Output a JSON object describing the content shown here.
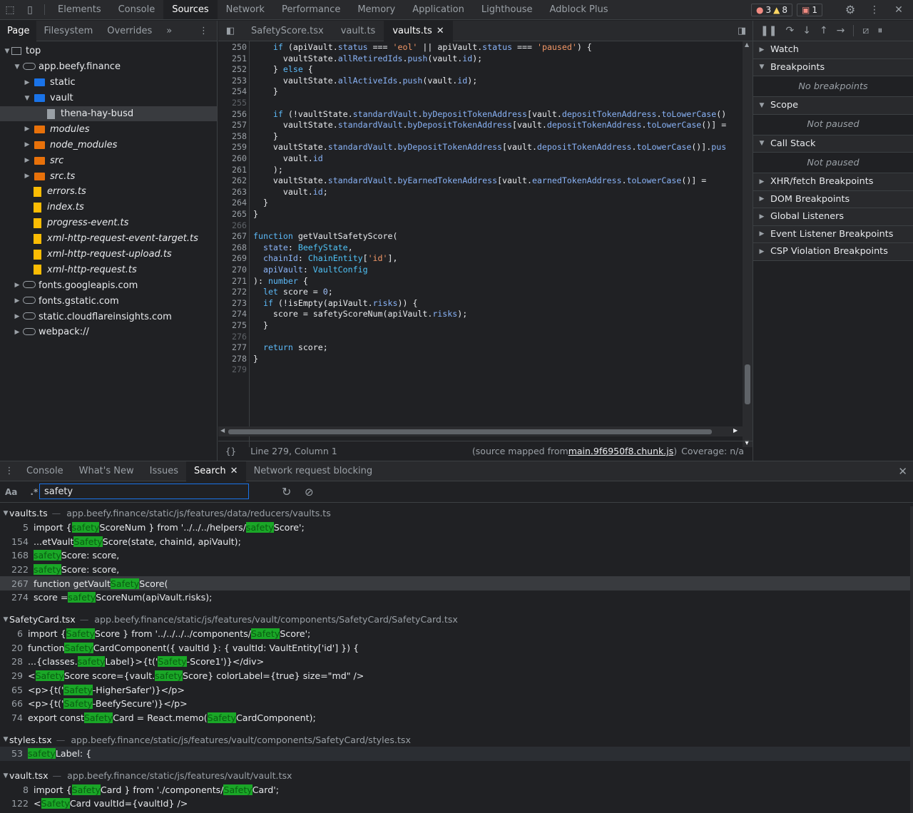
{
  "topbar": {
    "tabs": [
      "Elements",
      "Console",
      "Sources",
      "Network",
      "Performance",
      "Memory",
      "Application",
      "Lighthouse",
      "Adblock Plus"
    ],
    "active_tab": "Sources",
    "errors": "3",
    "warnings": "8",
    "issues": "1"
  },
  "navigator": {
    "tabs": [
      "Page",
      "Filesystem",
      "Overrides"
    ],
    "more": "»",
    "tree": [
      {
        "label": "top",
        "type": "frame",
        "depth": 0,
        "open": true
      },
      {
        "label": "app.beefy.finance",
        "type": "cloud",
        "depth": 1,
        "open": true
      },
      {
        "label": "static",
        "type": "folder",
        "depth": 2,
        "open": false
      },
      {
        "label": "vault",
        "type": "folder",
        "depth": 2,
        "open": true
      },
      {
        "label": "thena-hay-busd",
        "type": "file-gray",
        "depth": 3,
        "selected": true
      },
      {
        "label": "modules",
        "type": "folder-o",
        "depth": 2,
        "open": false,
        "italic": true
      },
      {
        "label": "node_modules",
        "type": "folder-o",
        "depth": 2,
        "open": false,
        "italic": true
      },
      {
        "label": "src",
        "type": "folder-o",
        "depth": 2,
        "open": false,
        "italic": true
      },
      {
        "label": "src.ts",
        "type": "folder-o",
        "depth": 2,
        "open": false,
        "italic": true
      },
      {
        "label": "errors.ts",
        "type": "file",
        "depth": 2,
        "italic": true
      },
      {
        "label": "index.ts",
        "type": "file",
        "depth": 2,
        "italic": true
      },
      {
        "label": "progress-event.ts",
        "type": "file",
        "depth": 2,
        "italic": true
      },
      {
        "label": "xml-http-request-event-target.ts",
        "type": "file",
        "depth": 2,
        "italic": true
      },
      {
        "label": "xml-http-request-upload.ts",
        "type": "file",
        "depth": 2,
        "italic": true
      },
      {
        "label": "xml-http-request.ts",
        "type": "file",
        "depth": 2,
        "italic": true
      },
      {
        "label": "fonts.googleapis.com",
        "type": "cloud",
        "depth": 1,
        "open": false
      },
      {
        "label": "fonts.gstatic.com",
        "type": "cloud",
        "depth": 1,
        "open": false
      },
      {
        "label": "static.cloudflareinsights.com",
        "type": "cloud",
        "depth": 1,
        "open": false
      },
      {
        "label": "webpack://",
        "type": "cloud",
        "depth": 1,
        "open": false
      }
    ]
  },
  "editor": {
    "tabs": [
      "SafetyScore.tsx",
      "vault.ts",
      "vaults.ts"
    ],
    "active_tab": "vaults.ts",
    "lines": [
      {
        "n": "250",
        "code": "    if (apiVault.status === 'eol' || apiVault.status === 'paused') {"
      },
      {
        "n": "251",
        "code": "      vaultState.allRetiredIds.push(vault.id);"
      },
      {
        "n": "252",
        "code": "    } else {"
      },
      {
        "n": "253",
        "code": "      vaultState.allActiveIds.push(vault.id);"
      },
      {
        "n": "254",
        "code": "    }"
      },
      {
        "n": "255",
        "code": ""
      },
      {
        "n": "256",
        "code": "    if (!vaultState.standardVault.byDepositTokenAddress[vault.depositTokenAddress.toLowerCase()"
      },
      {
        "n": "257",
        "code": "      vaultState.standardVault.byDepositTokenAddress[vault.depositTokenAddress.toLowerCase()] ="
      },
      {
        "n": "258",
        "code": "    }"
      },
      {
        "n": "259",
        "code": "    vaultState.standardVault.byDepositTokenAddress[vault.depositTokenAddress.toLowerCase()].pus"
      },
      {
        "n": "260",
        "code": "      vault.id"
      },
      {
        "n": "261",
        "code": "    );"
      },
      {
        "n": "262",
        "code": "    vaultState.standardVault.byEarnedTokenAddress[vault.earnedTokenAddress.toLowerCase()] ="
      },
      {
        "n": "263",
        "code": "      vault.id;"
      },
      {
        "n": "264",
        "code": "  }"
      },
      {
        "n": "265",
        "code": "}"
      },
      {
        "n": "266",
        "code": ""
      },
      {
        "n": "267",
        "code": "function getVaultSafetyScore("
      },
      {
        "n": "268",
        "code": "  state: BeefyState,"
      },
      {
        "n": "269",
        "code": "  chainId: ChainEntity['id'],"
      },
      {
        "n": "270",
        "code": "  apiVault: VaultConfig"
      },
      {
        "n": "271",
        "code": "): number {"
      },
      {
        "n": "272",
        "code": "  let score = 0;"
      },
      {
        "n": "273",
        "code": "  if (!isEmpty(apiVault.risks)) {"
      },
      {
        "n": "274",
        "code": "    score = safetyScoreNum(apiVault.risks);"
      },
      {
        "n": "275",
        "code": "  }"
      },
      {
        "n": "276",
        "code": ""
      },
      {
        "n": "277",
        "code": "  return score;"
      },
      {
        "n": "278",
        "code": "}"
      },
      {
        "n": "279",
        "code": ""
      }
    ],
    "status_position": "Line 279, Column 1",
    "status_source_prefix": "(source mapped from ",
    "status_source_link": "main.9f6950f8.chunk.js",
    "status_source_suffix": ")",
    "status_coverage": "Coverage: n/a"
  },
  "debugger": {
    "sections": [
      {
        "label": "Watch",
        "open": false
      },
      {
        "label": "Breakpoints",
        "open": true,
        "empty": "No breakpoints"
      },
      {
        "label": "Scope",
        "open": true,
        "empty": "Not paused"
      },
      {
        "label": "Call Stack",
        "open": true,
        "empty": "Not paused"
      },
      {
        "label": "XHR/fetch Breakpoints",
        "open": false
      },
      {
        "label": "DOM Breakpoints",
        "open": false
      },
      {
        "label": "Global Listeners",
        "open": false
      },
      {
        "label": "Event Listener Breakpoints",
        "open": false
      },
      {
        "label": "CSP Violation Breakpoints",
        "open": false
      }
    ]
  },
  "drawer": {
    "tabs": [
      "Console",
      "What's New",
      "Issues",
      "Search",
      "Network request blocking"
    ],
    "active_tab": "Search",
    "case_label": "Aa",
    "regex_label": ".*",
    "query": "safety",
    "results": [
      {
        "file": "vaults.ts",
        "path": "app.beefy.finance/static/js/features/data/reducers/vaults.ts",
        "lines": [
          {
            "n": "5",
            "pre": "import { ",
            "hit": "safety",
            "post": "ScoreNum } from '../../../helpers/",
            "hit2": "safety",
            "post2": "Score';"
          },
          {
            "n": "154",
            "pre": "...etVault",
            "hit": "Safety",
            "post": "Score(state, chainId, apiVault);"
          },
          {
            "n": "168",
            "pre": "",
            "hit": "safety",
            "post": "Score: score,"
          },
          {
            "n": "222",
            "pre": "",
            "hit": "safety",
            "post": "Score: score,"
          },
          {
            "n": "267",
            "pre": "function getVault",
            "hit": "Safety",
            "post": "Score(",
            "selected": true
          },
          {
            "n": "274",
            "pre": "score = ",
            "hit": "safety",
            "post": "ScoreNum(apiVault.risks);"
          }
        ]
      },
      {
        "file": "SafetyCard.tsx",
        "path": "app.beefy.finance/static/js/features/vault/components/SafetyCard/SafetyCard.tsx",
        "lines": [
          {
            "n": "6",
            "pre": "import { ",
            "hit": "Safety",
            "post": "Score } from '../../../../components/",
            "hit2": "Safety",
            "post2": "Score';"
          },
          {
            "n": "20",
            "pre": "function ",
            "hit": "Safety",
            "post": "CardComponent({ vaultId }: { vaultId: VaultEntity['id'] }) {"
          },
          {
            "n": "28",
            "pre": "...{classes.",
            "hit": "safety",
            "post": "Label}>{t('",
            "hit2": "Safety",
            "post2": "-Score1')}</div>"
          },
          {
            "n": "29",
            "pre": "<",
            "hit": "Safety",
            "post": "Score score={vault.",
            "hit2": "safety",
            "post2": "Score} colorLabel={true} size=\"md\" />"
          },
          {
            "n": "65",
            "pre": "<p>{t('",
            "hit": "Safety",
            "post": "-HigherSafer')}</p>"
          },
          {
            "n": "66",
            "pre": "<p>{t('",
            "hit": "Safety",
            "post": "-BeefySecure')}</p>"
          },
          {
            "n": "74",
            "pre": "export const ",
            "hit": "Safety",
            "post": "Card = React.memo(",
            "hit2": "Safety",
            "post2": "CardComponent);"
          }
        ]
      },
      {
        "file": "styles.tsx",
        "path": "app.beefy.finance/static/js/features/vault/components/SafetyCard/styles.tsx",
        "lines": [
          {
            "n": "53",
            "pre": "",
            "hit": "safety",
            "post": "Label: {",
            "hover": true
          }
        ]
      },
      {
        "file": "vault.tsx",
        "path": "app.beefy.finance/static/js/features/vault/vault.tsx",
        "lines": [
          {
            "n": "8",
            "pre": "import { ",
            "hit": "Safety",
            "post": "Card } from './components/",
            "hit2": "Safety",
            "post2": "Card';"
          },
          {
            "n": "122",
            "pre": "<",
            "hit": "Safety",
            "post": "Card vaultId={vaultId} />"
          }
        ]
      }
    ]
  }
}
